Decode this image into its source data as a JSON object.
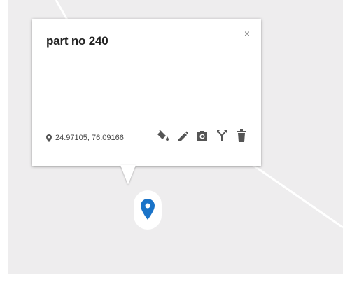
{
  "popup": {
    "title": "part no 240",
    "close_label": "×",
    "coordinates": "24.97105, 76.09166"
  },
  "icons": {
    "location": "location-pin-icon",
    "style": "paint-bucket-icon",
    "edit": "pencil-icon",
    "photo": "camera-icon",
    "directions": "fork-directions-icon",
    "delete": "trash-icon"
  },
  "colors": {
    "map_background": "#eeedee",
    "road": "#ffffff",
    "marker": "#1a73c8"
  }
}
